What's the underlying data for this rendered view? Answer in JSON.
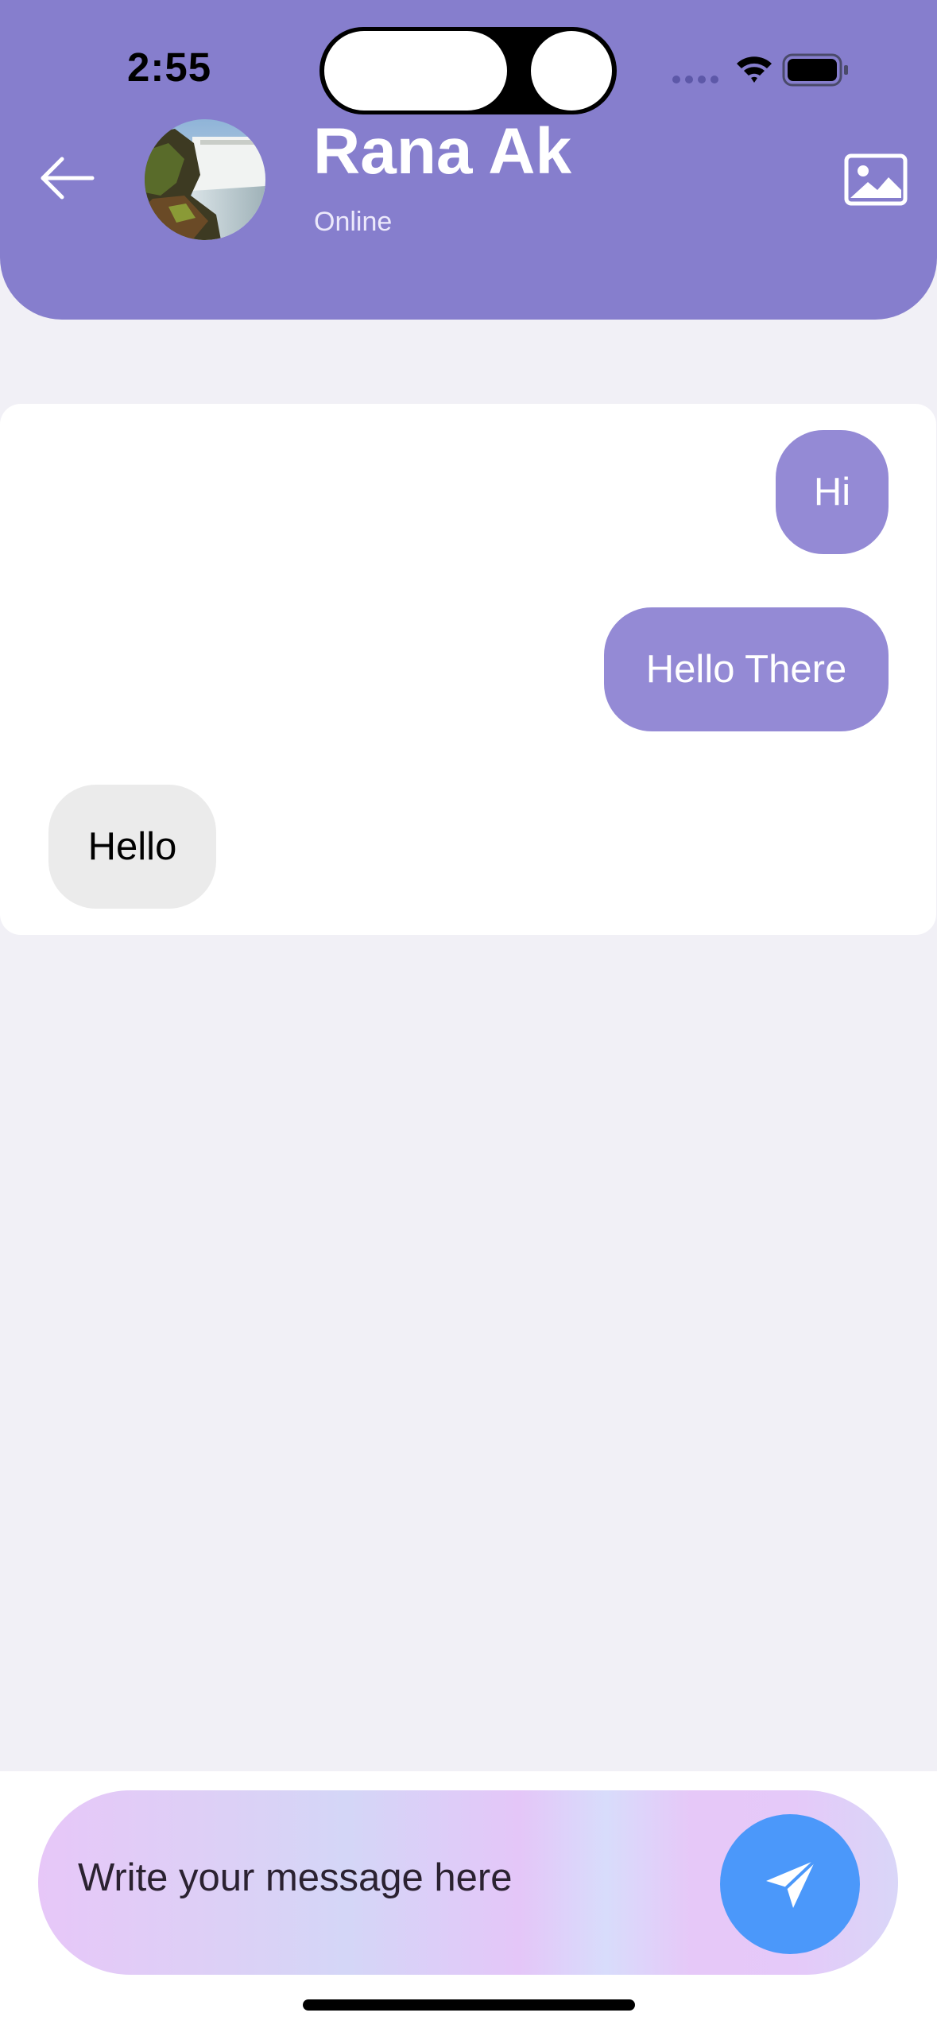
{
  "status_bar": {
    "time": "2:55"
  },
  "header": {
    "contact_name": "Rana Ak",
    "contact_status": "Online",
    "back_icon": "arrow-left-icon",
    "image_icon": "image-icon",
    "background_color": "#867ecd"
  },
  "messages": [
    {
      "text": "Hi",
      "direction": "sent"
    },
    {
      "text": "Hello There",
      "direction": "sent"
    },
    {
      "text": "Hello",
      "direction": "received"
    }
  ],
  "composer": {
    "placeholder": "Write your message here",
    "send_icon": "paper-plane-icon",
    "send_color": "#4b98fa"
  },
  "colors": {
    "sent_bubble": "#948ad5",
    "received_bubble": "#ebebeb",
    "background": "#f1f0f6"
  }
}
